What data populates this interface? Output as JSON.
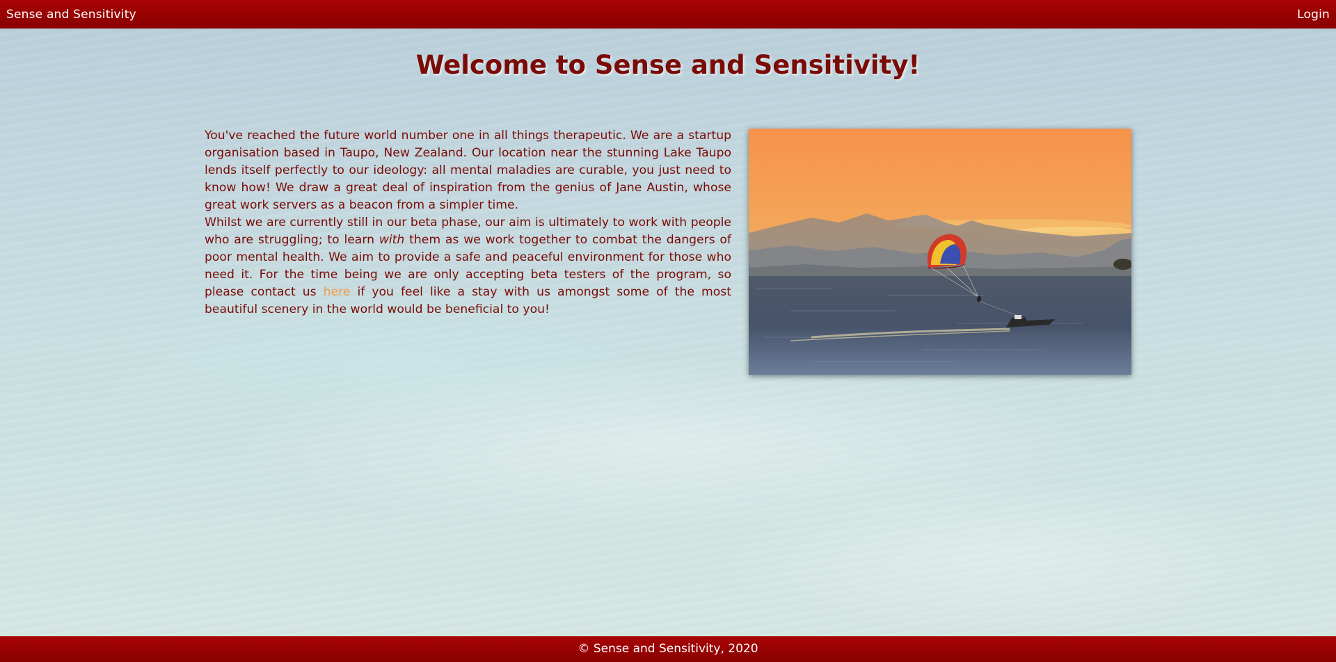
{
  "nav": {
    "brand": "Sense and Sensitivity",
    "login": "Login"
  },
  "main": {
    "headline": "Welcome to Sense and Sensitivity!",
    "paragraph1": "You've reached the future world number one in all things therapeutic. We are a startup organisation based in Taupo, New Zealand. Our location near the stunning Lake Taupo lends itself perfectly to our ideology: all mental maladies are curable, you just need to know how! We draw a great deal of inspiration from the genius of Jane Austin, whose great work servers as a beacon from a simpler time.",
    "paragraph2": {
      "before_em": "Whilst we are currently still in our beta phase, our aim is ultimately to work with people who are struggling; to learn ",
      "em": "with",
      "after_em": " them as we work together to combat the dangers of poor mental health. We aim to provide a safe and peaceful environment for those who need it. For the time being we are only accepting beta testers of the program, so please contact us ",
      "link": "here",
      "after_link": " if you feel like a stay with us amongst some of the most beautiful scenery in the world would be beneficial to you!"
    }
  },
  "footer": {
    "text": "© Sense and Sensitivity, 2020"
  },
  "colors": {
    "navbar": "#9b0202",
    "headline": "#7a0b06",
    "link": "#f29a4a"
  },
  "icons": {
    "photo": "lake-parasail-photo"
  }
}
